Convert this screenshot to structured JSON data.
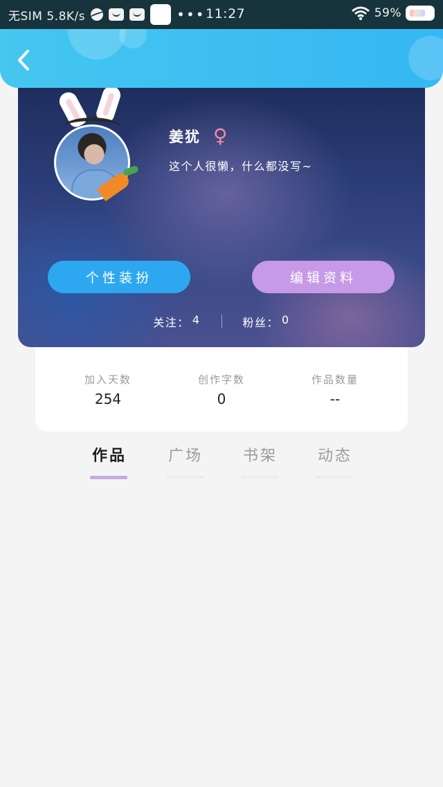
{
  "status_bar": {
    "carrier": "无SIM 5.8K/s",
    "time": "11:27",
    "dots": "•••",
    "battery": "59%"
  },
  "header": {
    "back_icon": "chevron-left-icon"
  },
  "profile": {
    "username": "姜犹",
    "gender_symbol": "♀",
    "bio": "这个人很懒，什么都没写~",
    "dress_button": "个性装扮",
    "edit_button": "编辑资料",
    "following_label": "关注：",
    "following_count": "4",
    "fans_label": "粉丝：",
    "fans_count": "0"
  },
  "stats": [
    {
      "label": "加入天数",
      "value": "254"
    },
    {
      "label": "创作字数",
      "value": "0"
    },
    {
      "label": "作品数量",
      "value": "--"
    }
  ],
  "tabs": [
    {
      "label": "作品",
      "active": true
    },
    {
      "label": "广场",
      "active": false
    },
    {
      "label": "书架",
      "active": false
    },
    {
      "label": "动态",
      "active": false
    }
  ],
  "colors": {
    "header": "#3bbdf2",
    "dress_button": "#2ea7f1",
    "edit_button": "#c69ae6",
    "active_tab_underline": "#c7a9e6",
    "gender_icon": "#f28ba2"
  }
}
